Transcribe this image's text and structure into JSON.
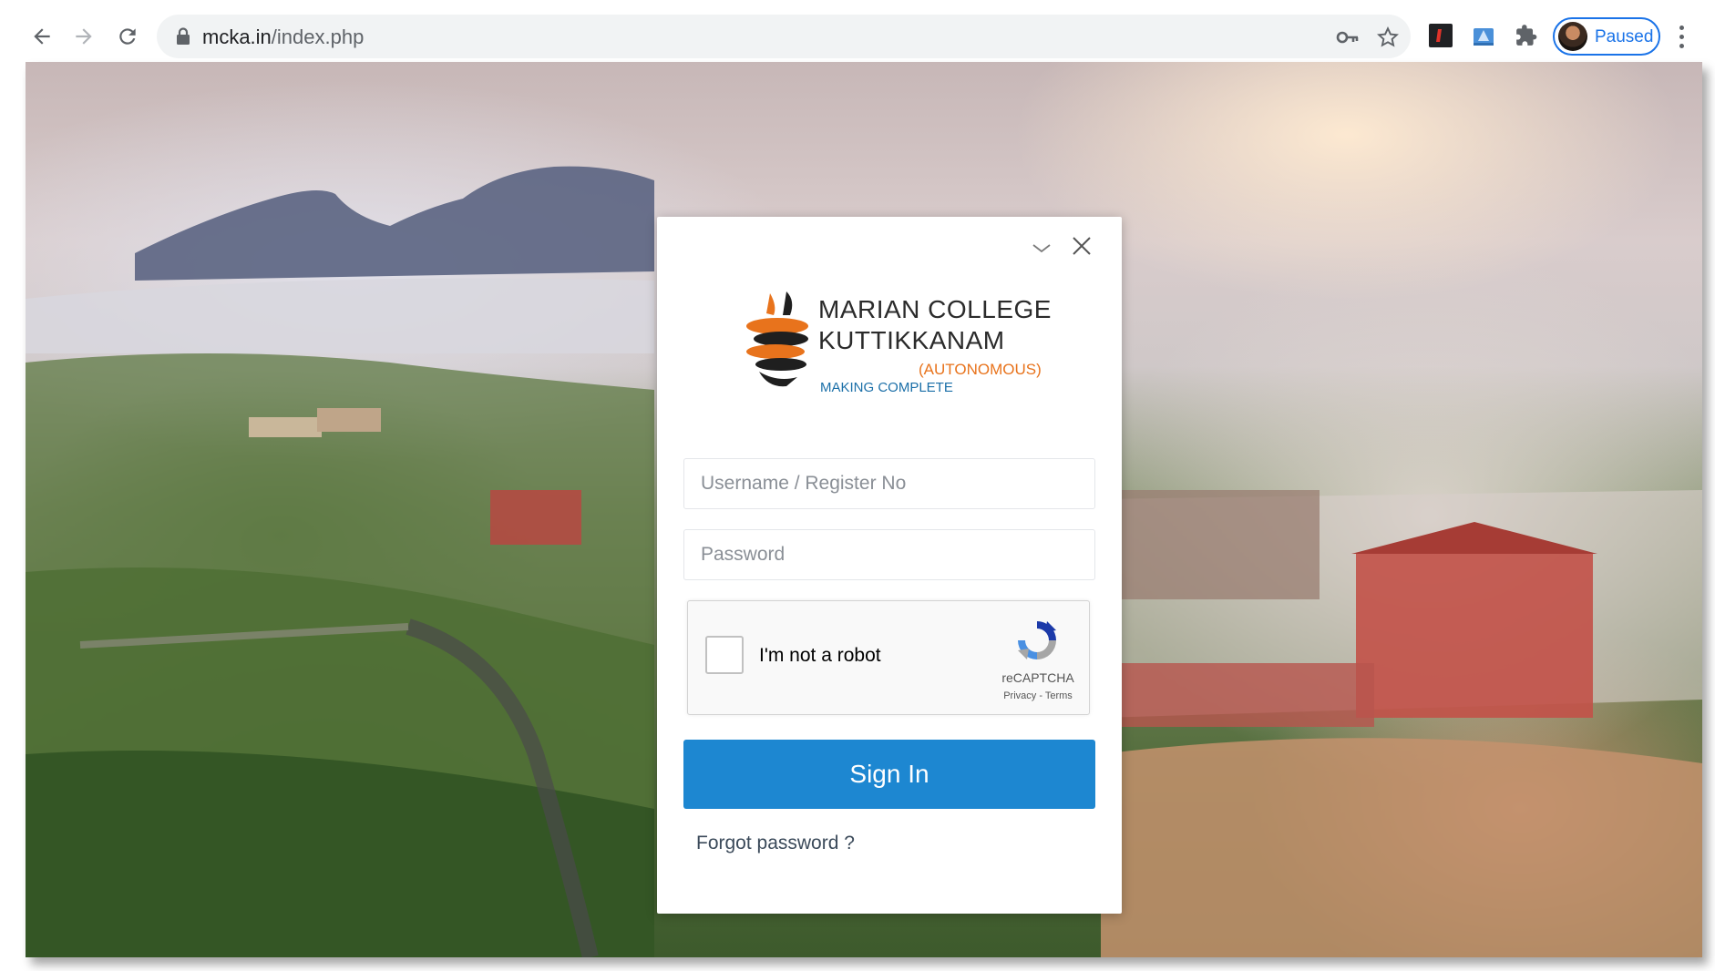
{
  "browser": {
    "address_bar": {
      "url_host": "mcka.in",
      "url_path": "/index.php"
    },
    "profile": {
      "status_label": "Paused"
    },
    "icons": [
      "back-icon",
      "forward-icon",
      "reload-icon",
      "lock-icon",
      "key-icon",
      "star-icon",
      "extension-1-icon",
      "extension-2-icon",
      "puzzle-icon",
      "menu-icon"
    ]
  },
  "login": {
    "logo": {
      "line1": "MARIAN COLLEGE",
      "line2": "KUTTIKKANAM",
      "autonomous": "(AUTONOMOUS)",
      "tagline": "MAKING COMPLETE"
    },
    "username_placeholder": "Username / Register No",
    "password_placeholder": "Password",
    "captcha": {
      "label": "I'm not a robot",
      "brand": "reCAPTCHA",
      "links": "Privacy - Terms"
    },
    "signin_label": "Sign In",
    "forgot_label": "Forgot password ?"
  },
  "colors": {
    "signin_button": "#1d87d1",
    "logo_orange": "#e8731c",
    "logo_blue": "#1b6fa8",
    "chrome_accent": "#1a73e8"
  }
}
